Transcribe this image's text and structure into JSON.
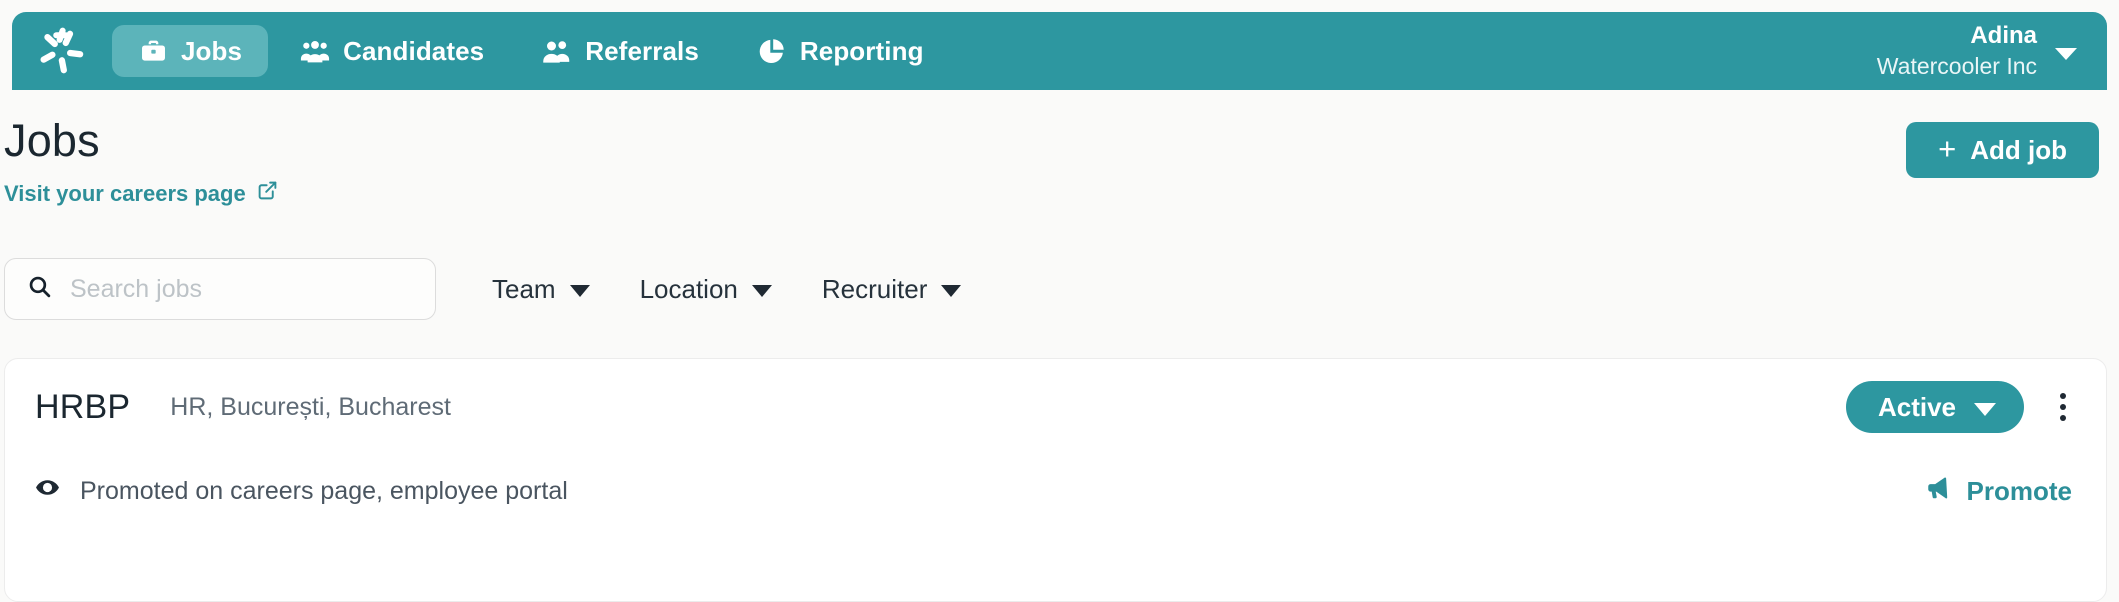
{
  "brand": {
    "logo_icon": "pinwheel-logo-icon"
  },
  "nav": {
    "items": [
      {
        "label": "Jobs",
        "icon": "briefcase-icon",
        "active": true
      },
      {
        "label": "Candidates",
        "icon": "people-group-icon",
        "active": false
      },
      {
        "label": "Referrals",
        "icon": "two-people-icon",
        "active": false
      },
      {
        "label": "Reporting",
        "icon": "pie-chart-icon",
        "active": false
      }
    ]
  },
  "user": {
    "name": "Adina",
    "organization": "Watercooler Inc",
    "caret_icon": "chevron-down-icon"
  },
  "page": {
    "title": "Jobs",
    "careers_link": "Visit your careers page",
    "careers_link_icon": "external-link-icon",
    "add_job_label": "Add job",
    "add_job_icon": "plus-icon"
  },
  "search": {
    "placeholder": "Search jobs",
    "value": "",
    "icon": "search-icon"
  },
  "filters": [
    {
      "label": "Team",
      "icon": "chevron-down-icon"
    },
    {
      "label": "Location",
      "icon": "chevron-down-icon"
    },
    {
      "label": "Recruiter",
      "icon": "chevron-down-icon"
    }
  ],
  "job": {
    "title": "HRBP",
    "meta": "HR, București, Bucharest",
    "status_label": "Active",
    "status_caret_icon": "chevron-down-icon",
    "menu_icon": "kebab-menu-icon",
    "promoted_icon": "eye-icon",
    "promoted_text": "Promoted on careers page, employee portal",
    "promote_label": "Promote",
    "promote_icon": "megaphone-icon"
  },
  "colors": {
    "teal": "#2d97a0",
    "teal_active_tab": "#5cb4ba",
    "link_teal": "#2d8f99",
    "page_background": "#fafaf9",
    "card_background": "#ffffff",
    "card_border": "#ececec",
    "text_primary": "#1b2730",
    "text_muted": "#5f6b76",
    "placeholder": "#bdc3c7"
  }
}
